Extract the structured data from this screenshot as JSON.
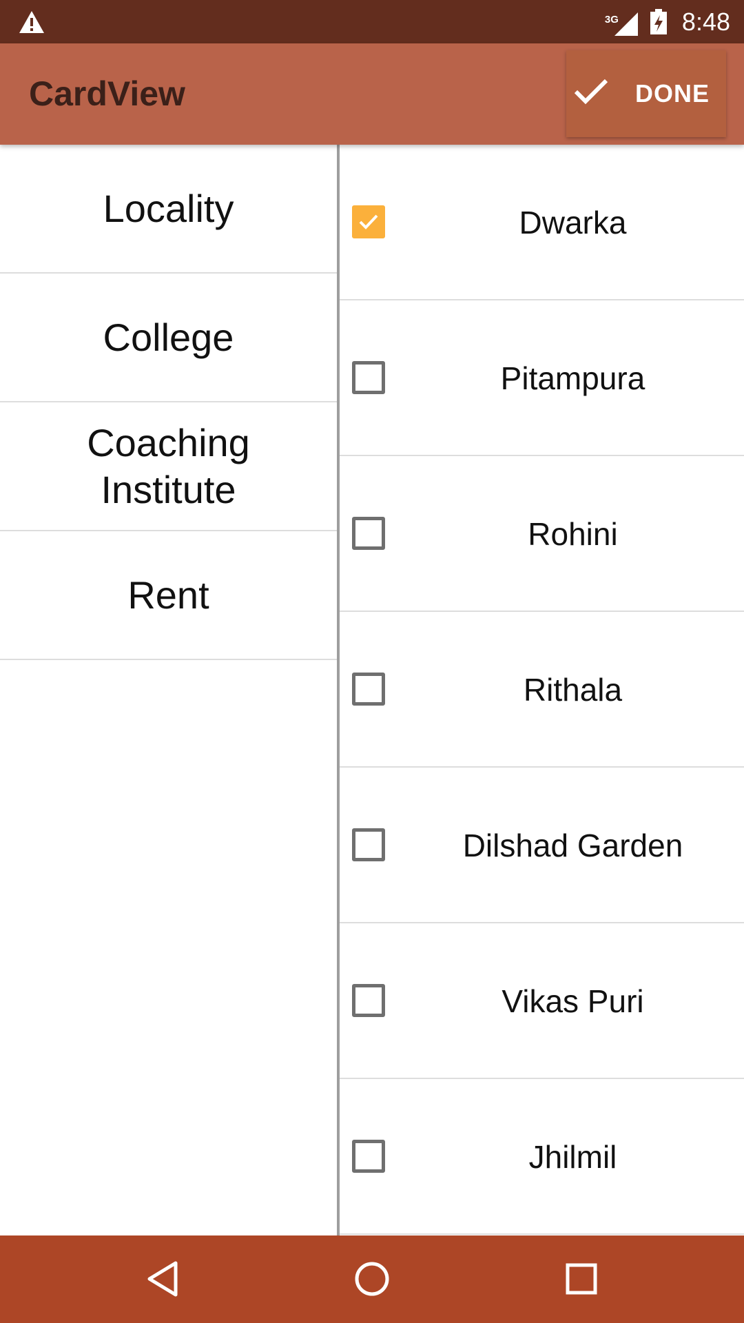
{
  "status_bar": {
    "time": "8:48",
    "network": "3G",
    "icons": [
      "warning-icon",
      "signal-icon",
      "battery-icon"
    ]
  },
  "app_bar": {
    "title": "CardView",
    "done_label": "DONE",
    "done_icon": "check-icon"
  },
  "categories": [
    {
      "label": "Locality"
    },
    {
      "label": "College"
    },
    {
      "label": "Coaching Institute"
    },
    {
      "label": "Rent"
    }
  ],
  "localities": [
    {
      "label": "Dwarka",
      "checked": true
    },
    {
      "label": "Pitampura",
      "checked": false
    },
    {
      "label": "Rohini",
      "checked": false
    },
    {
      "label": "Rithala",
      "checked": false
    },
    {
      "label": "Dilshad Garden",
      "checked": false
    },
    {
      "label": "Vikas Puri",
      "checked": false
    },
    {
      "label": "Jhilmil",
      "checked": false
    }
  ],
  "nav_bar": {
    "icons": [
      "back-icon",
      "home-icon",
      "recents-icon"
    ]
  },
  "colors": {
    "status_bar": "#632d1e",
    "app_bar": "#b9634a",
    "nav_bar": "#ad4626",
    "checkbox_checked": "#fbb03b"
  }
}
